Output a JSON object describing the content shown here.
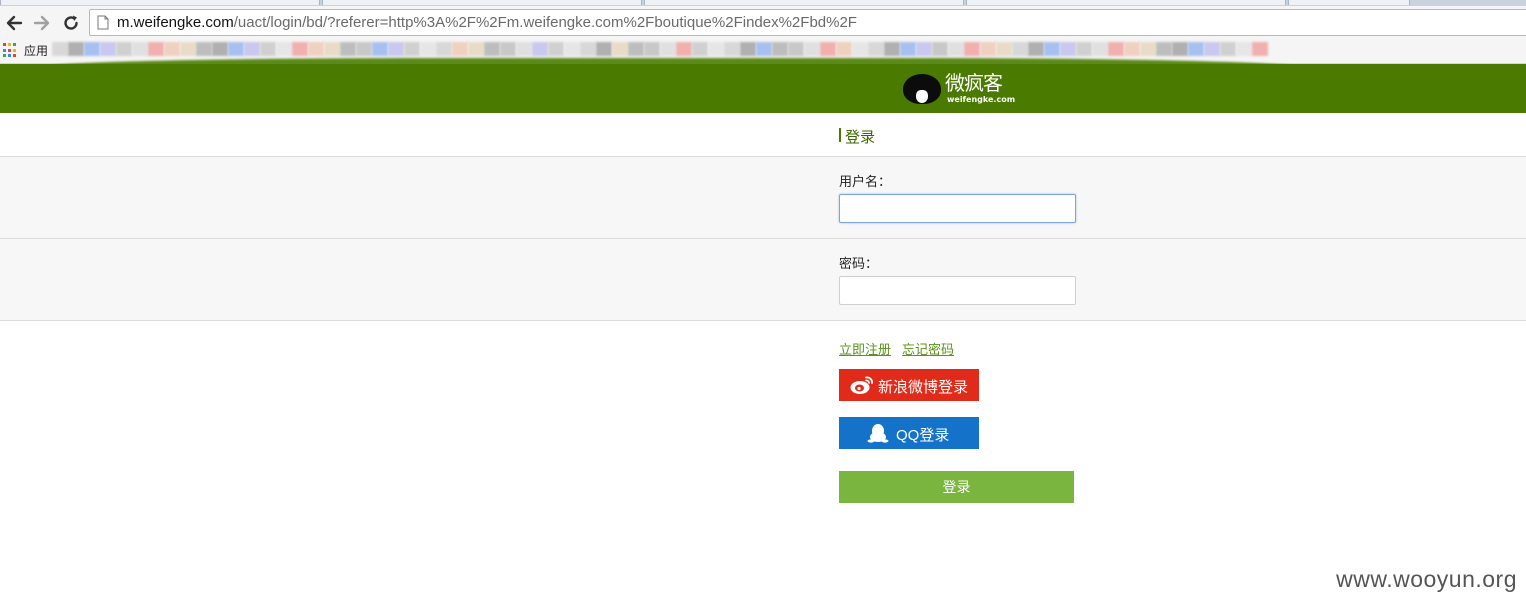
{
  "browser": {
    "address_bar": {
      "host": "m.weifengke.com",
      "path": "/uact/login/bd/?referer=http%3A%2F%2Fm.weifengke.com%2Fboutique%2Findex%2Fbd%2F"
    },
    "bookmarks_bar": {
      "apps_label": "应用"
    }
  },
  "site": {
    "logo": {
      "name": "微疯客",
      "domain": "weifengke.com"
    }
  },
  "login": {
    "title": "登录",
    "username_label": "用户名：",
    "username_value": "",
    "password_label": "密码：",
    "password_value": "",
    "register_link": "立即注册",
    "forgot_link": "忘记密码",
    "weibo_button": "新浪微博登录",
    "qq_button": "QQ登录",
    "submit_button": "登录"
  },
  "colors": {
    "header_green": "#4a7a00",
    "link_green": "#5a9216",
    "weibo_red": "#e02a1a",
    "qq_blue": "#1473c9",
    "submit_green": "#7ab540"
  },
  "watermark": "www.wooyun.org"
}
